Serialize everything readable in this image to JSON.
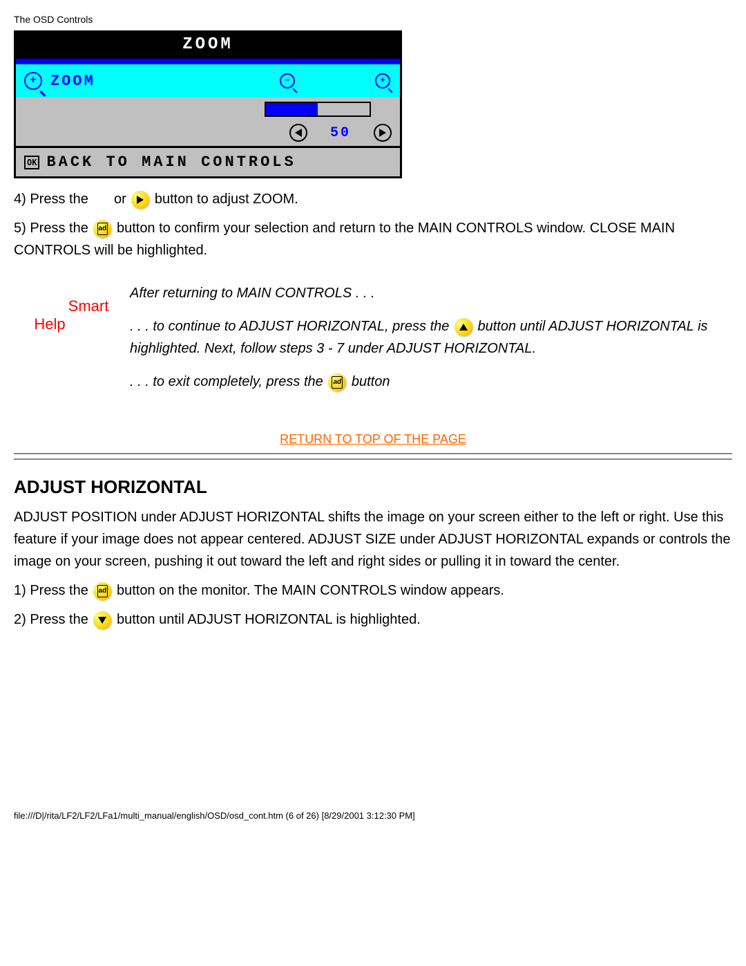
{
  "header": "The OSD Controls",
  "osd": {
    "title": "ZOOM",
    "label": "ZOOM",
    "value": "50",
    "footer": "BACK TO MAIN CONTROLS"
  },
  "step4_a": "4) Press the ",
  "step4_or": " or ",
  "step4_b": " button to adjust ZOOM.",
  "step5_a": "5) Press the ",
  "step5_b": " button to confirm your selection and return to the MAIN CONTROLS window. CLOSE MAIN CONTROLS will be highlighted.",
  "smart_help": {
    "smart": "Smart",
    "help": "Help",
    "line1": "After returning to MAIN CONTROLS . . .",
    "line2a": ". . . to continue to ADJUST HORIZONTAL, press the ",
    "line2b": " button until ADJUST HORIZONTAL is highlighted. Next, follow steps 3 - 7 under ADJUST HORIZONTAL.",
    "line3a": ". . . to exit completely, press the ",
    "line3b": " button"
  },
  "return_link": "RETURN TO TOP OF THE PAGE",
  "heading2": "ADJUST HORIZONTAL",
  "para2": "ADJUST POSITION under ADJUST HORIZONTAL shifts the image on your screen either to the left or right. Use this feature if your image does not appear centered. ADJUST SIZE under ADJUST HORIZONTAL expands or controls the image on your screen, pushing it out toward the left and right sides or pulling it in toward the center.",
  "ah_step1_a": "1) Press the ",
  "ah_step1_b": " button on the monitor. The MAIN CONTROLS window appears.",
  "ah_step2_a": "2) Press the ",
  "ah_step2_b": " button until ADJUST HORIZONTAL is highlighted.",
  "footer_path": "file:///D|/rita/LF2/LF2/LFa1/multi_manual/english/OSD/osd_cont.htm (6 of 26) [8/29/2001 3:12:30 PM]"
}
